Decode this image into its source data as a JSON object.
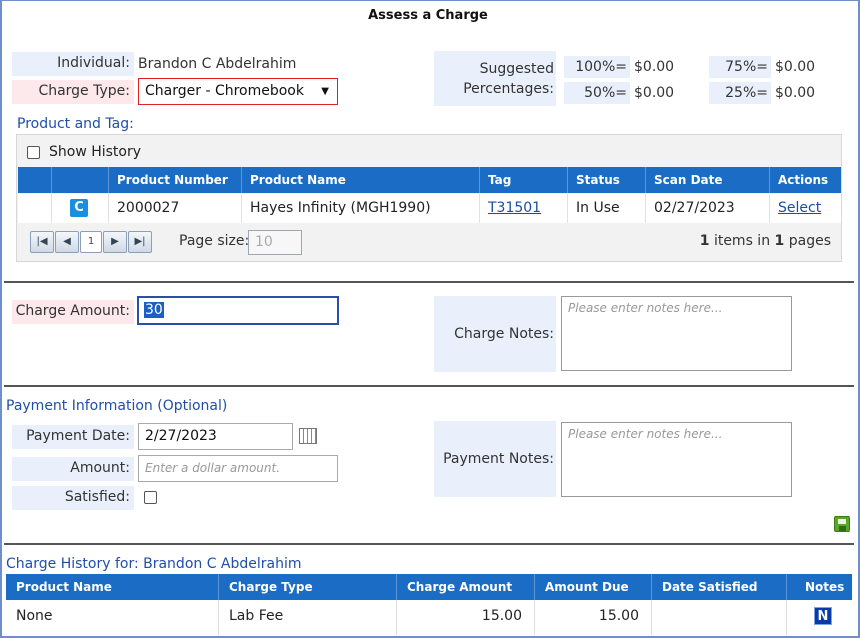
{
  "title": "Assess a Charge",
  "individual": {
    "label": "Individual:",
    "value": "Brandon C Abdelrahim"
  },
  "charge_type": {
    "label": "Charge Type:",
    "value": "Charger - Chromebook"
  },
  "suggested": {
    "label": "Suggested Percentages:",
    "items": [
      {
        "pct": "100%=",
        "amount": "$0.00"
      },
      {
        "pct": "75%=",
        "amount": "$0.00"
      },
      {
        "pct": "50%=",
        "amount": "$0.00"
      },
      {
        "pct": "25%=",
        "amount": "$0.00"
      }
    ]
  },
  "product_tag": {
    "heading": "Product and Tag:",
    "show_history": "Show History",
    "columns": [
      "",
      "",
      "Product Number",
      "Product Name",
      "Tag",
      "Status",
      "Scan Date",
      "Actions"
    ],
    "row": {
      "icon_letter": "C",
      "product_number": "2000027",
      "product_name": "Hayes Infinity (MGH1990)",
      "tag": "T31501",
      "status": "In Use",
      "scan_date": "02/27/2023",
      "action": "Select"
    },
    "pager": {
      "current_page": "1",
      "page_size_label": "Page size:",
      "page_size": "10",
      "items_count": "1",
      "items_in": "items in",
      "pages_count": "1",
      "pages_label": "pages"
    }
  },
  "charge": {
    "amount_label": "Charge Amount:",
    "amount_value": "30",
    "notes_label": "Charge Notes:",
    "notes_placeholder": "Please enter notes here..."
  },
  "payment": {
    "heading": "Payment Information (Optional)",
    "date_label": "Payment Date:",
    "date_value": "2/27/2023",
    "amount_label": "Amount:",
    "amount_placeholder": "Enter a dollar amount.",
    "satisfied_label": "Satisfied:",
    "notes_label": "Payment Notes:",
    "notes_placeholder": "Please enter notes here..."
  },
  "history": {
    "heading": "Charge History for: Brandon C Abdelrahim",
    "columns": [
      "Product Name",
      "Charge Type",
      "Charge Amount",
      "Amount Due",
      "Date Satisfied",
      "Notes"
    ],
    "row": {
      "product_name": "None",
      "charge_type": "Lab Fee",
      "charge_amount": "15.00",
      "amount_due": "15.00",
      "date_satisfied": "",
      "notes_icon_letter": "N"
    }
  },
  "colors": {
    "accent": "#1a6cc4",
    "label_bg": "#e9f0fb",
    "required_bg": "#fde8ec",
    "heading": "#1f4fa8"
  }
}
